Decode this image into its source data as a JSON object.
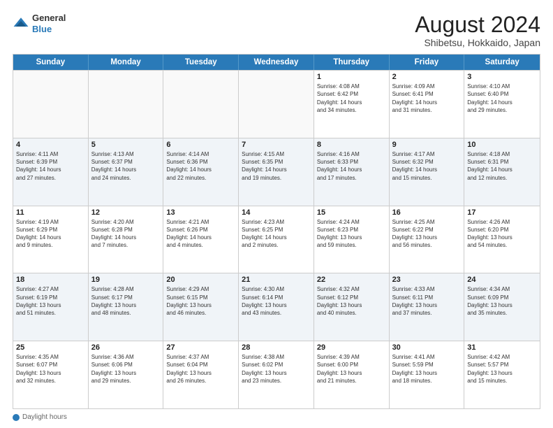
{
  "logo": {
    "general": "General",
    "blue": "Blue"
  },
  "title": "August 2024",
  "subtitle": "Shibetsu, Hokkaido, Japan",
  "header": {
    "days": [
      "Sunday",
      "Monday",
      "Tuesday",
      "Wednesday",
      "Thursday",
      "Friday",
      "Saturday"
    ]
  },
  "footer": {
    "daylight_label": "Daylight hours"
  },
  "weeks": [
    {
      "cells": [
        {
          "day": "",
          "content": "",
          "empty": true
        },
        {
          "day": "",
          "content": "",
          "empty": true
        },
        {
          "day": "",
          "content": "",
          "empty": true
        },
        {
          "day": "",
          "content": "",
          "empty": true
        },
        {
          "day": "1",
          "content": "Sunrise: 4:08 AM\nSunset: 6:42 PM\nDaylight: 14 hours\nand 34 minutes.",
          "empty": false
        },
        {
          "day": "2",
          "content": "Sunrise: 4:09 AM\nSunset: 6:41 PM\nDaylight: 14 hours\nand 31 minutes.",
          "empty": false
        },
        {
          "day": "3",
          "content": "Sunrise: 4:10 AM\nSunset: 6:40 PM\nDaylight: 14 hours\nand 29 minutes.",
          "empty": false
        }
      ]
    },
    {
      "cells": [
        {
          "day": "4",
          "content": "Sunrise: 4:11 AM\nSunset: 6:39 PM\nDaylight: 14 hours\nand 27 minutes.",
          "empty": false
        },
        {
          "day": "5",
          "content": "Sunrise: 4:13 AM\nSunset: 6:37 PM\nDaylight: 14 hours\nand 24 minutes.",
          "empty": false
        },
        {
          "day": "6",
          "content": "Sunrise: 4:14 AM\nSunset: 6:36 PM\nDaylight: 14 hours\nand 22 minutes.",
          "empty": false
        },
        {
          "day": "7",
          "content": "Sunrise: 4:15 AM\nSunset: 6:35 PM\nDaylight: 14 hours\nand 19 minutes.",
          "empty": false
        },
        {
          "day": "8",
          "content": "Sunrise: 4:16 AM\nSunset: 6:33 PM\nDaylight: 14 hours\nand 17 minutes.",
          "empty": false
        },
        {
          "day": "9",
          "content": "Sunrise: 4:17 AM\nSunset: 6:32 PM\nDaylight: 14 hours\nand 15 minutes.",
          "empty": false
        },
        {
          "day": "10",
          "content": "Sunrise: 4:18 AM\nSunset: 6:31 PM\nDaylight: 14 hours\nand 12 minutes.",
          "empty": false
        }
      ]
    },
    {
      "cells": [
        {
          "day": "11",
          "content": "Sunrise: 4:19 AM\nSunset: 6:29 PM\nDaylight: 14 hours\nand 9 minutes.",
          "empty": false
        },
        {
          "day": "12",
          "content": "Sunrise: 4:20 AM\nSunset: 6:28 PM\nDaylight: 14 hours\nand 7 minutes.",
          "empty": false
        },
        {
          "day": "13",
          "content": "Sunrise: 4:21 AM\nSunset: 6:26 PM\nDaylight: 14 hours\nand 4 minutes.",
          "empty": false
        },
        {
          "day": "14",
          "content": "Sunrise: 4:23 AM\nSunset: 6:25 PM\nDaylight: 14 hours\nand 2 minutes.",
          "empty": false
        },
        {
          "day": "15",
          "content": "Sunrise: 4:24 AM\nSunset: 6:23 PM\nDaylight: 13 hours\nand 59 minutes.",
          "empty": false
        },
        {
          "day": "16",
          "content": "Sunrise: 4:25 AM\nSunset: 6:22 PM\nDaylight: 13 hours\nand 56 minutes.",
          "empty": false
        },
        {
          "day": "17",
          "content": "Sunrise: 4:26 AM\nSunset: 6:20 PM\nDaylight: 13 hours\nand 54 minutes.",
          "empty": false
        }
      ]
    },
    {
      "cells": [
        {
          "day": "18",
          "content": "Sunrise: 4:27 AM\nSunset: 6:19 PM\nDaylight: 13 hours\nand 51 minutes.",
          "empty": false
        },
        {
          "day": "19",
          "content": "Sunrise: 4:28 AM\nSunset: 6:17 PM\nDaylight: 13 hours\nand 48 minutes.",
          "empty": false
        },
        {
          "day": "20",
          "content": "Sunrise: 4:29 AM\nSunset: 6:15 PM\nDaylight: 13 hours\nand 46 minutes.",
          "empty": false
        },
        {
          "day": "21",
          "content": "Sunrise: 4:30 AM\nSunset: 6:14 PM\nDaylight: 13 hours\nand 43 minutes.",
          "empty": false
        },
        {
          "day": "22",
          "content": "Sunrise: 4:32 AM\nSunset: 6:12 PM\nDaylight: 13 hours\nand 40 minutes.",
          "empty": false
        },
        {
          "day": "23",
          "content": "Sunrise: 4:33 AM\nSunset: 6:11 PM\nDaylight: 13 hours\nand 37 minutes.",
          "empty": false
        },
        {
          "day": "24",
          "content": "Sunrise: 4:34 AM\nSunset: 6:09 PM\nDaylight: 13 hours\nand 35 minutes.",
          "empty": false
        }
      ]
    },
    {
      "cells": [
        {
          "day": "25",
          "content": "Sunrise: 4:35 AM\nSunset: 6:07 PM\nDaylight: 13 hours\nand 32 minutes.",
          "empty": false
        },
        {
          "day": "26",
          "content": "Sunrise: 4:36 AM\nSunset: 6:06 PM\nDaylight: 13 hours\nand 29 minutes.",
          "empty": false
        },
        {
          "day": "27",
          "content": "Sunrise: 4:37 AM\nSunset: 6:04 PM\nDaylight: 13 hours\nand 26 minutes.",
          "empty": false
        },
        {
          "day": "28",
          "content": "Sunrise: 4:38 AM\nSunset: 6:02 PM\nDaylight: 13 hours\nand 23 minutes.",
          "empty": false
        },
        {
          "day": "29",
          "content": "Sunrise: 4:39 AM\nSunset: 6:00 PM\nDaylight: 13 hours\nand 21 minutes.",
          "empty": false
        },
        {
          "day": "30",
          "content": "Sunrise: 4:41 AM\nSunset: 5:59 PM\nDaylight: 13 hours\nand 18 minutes.",
          "empty": false
        },
        {
          "day": "31",
          "content": "Sunrise: 4:42 AM\nSunset: 5:57 PM\nDaylight: 13 hours\nand 15 minutes.",
          "empty": false
        }
      ]
    }
  ]
}
